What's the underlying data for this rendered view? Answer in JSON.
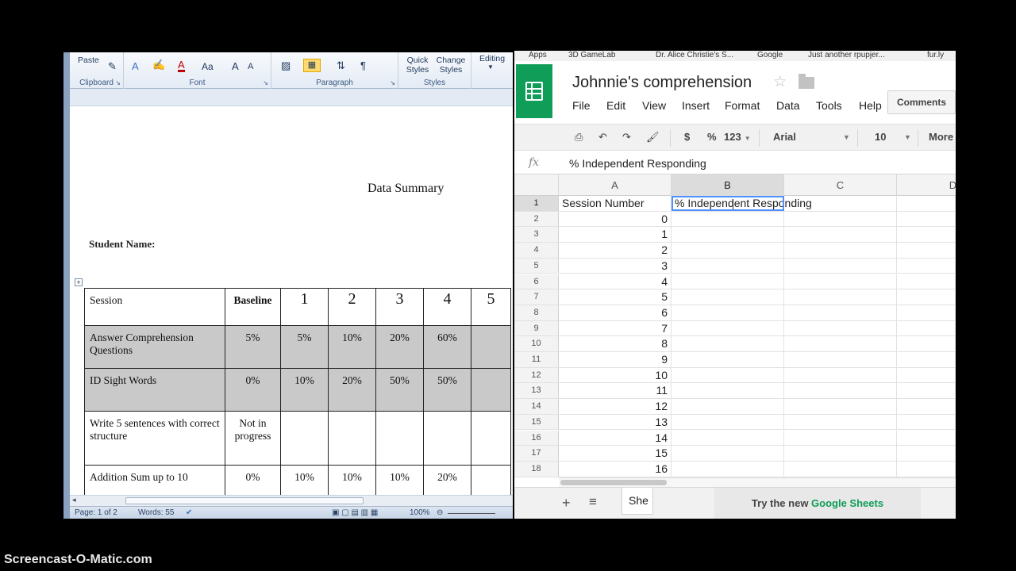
{
  "word": {
    "ribbon": {
      "paste_label": "Paste",
      "clipboard_label": "Clipboard",
      "font_label": "Font",
      "paragraph_label": "Paragraph",
      "quick_styles_label": "Quick Styles",
      "change_styles_label": "Change Styles",
      "styles_label": "Styles",
      "editing_label": "Editing",
      "font_size_grow": "A",
      "font_case": "Aa"
    },
    "document": {
      "title": "Data Summary",
      "student_label": "Student Name:",
      "table": {
        "header": [
          "Session",
          "Baseline",
          "1",
          "2",
          "3",
          "4",
          "5"
        ],
        "rows": [
          {
            "label": "Answer Comprehension Questions",
            "baseline": "5%",
            "values": [
              "5%",
              "10%",
              "20%",
              "60%",
              ""
            ]
          },
          {
            "label": "ID Sight Words",
            "baseline": "0%",
            "values": [
              "10%",
              "20%",
              "50%",
              "50%",
              ""
            ]
          },
          {
            "label": "Write 5 sentences with correct structure",
            "baseline": "Not in progress",
            "values": [
              "",
              "",
              "",
              "",
              ""
            ]
          },
          {
            "label": "Addition Sum up to 10",
            "baseline": "0%",
            "values": [
              "10%",
              "10%",
              "10%",
              "20%",
              ""
            ]
          }
        ]
      }
    },
    "status": {
      "page": "Page: 1 of 2",
      "words": "Words: 55",
      "zoom": "100%"
    }
  },
  "sheets": {
    "bookmarks": [
      "Apps",
      "3D GameLab",
      "Dr. Alice Christie's S...",
      "Google",
      "Just another rpupjer...",
      "fur.ly"
    ],
    "doc_name": "Johnnie's comprehension",
    "menu": [
      "File",
      "Edit",
      "View",
      "Insert",
      "Format",
      "Data",
      "Tools",
      "Help"
    ],
    "comments_label": "Comments",
    "toolbar": {
      "currency": "$",
      "percent": "%",
      "number_format": "123",
      "font": "Arial",
      "font_size": "10",
      "more": "More"
    },
    "formula_bar": {
      "fx": "fx",
      "value": "% Independent Responding"
    },
    "columns": [
      "A",
      "B",
      "C",
      "D"
    ],
    "rows": [
      {
        "num": "1",
        "a": "Session Number",
        "b": "% Independent Responding"
      },
      {
        "num": "2",
        "a": "0",
        "b": ""
      },
      {
        "num": "3",
        "a": "1",
        "b": ""
      },
      {
        "num": "4",
        "a": "2",
        "b": ""
      },
      {
        "num": "5",
        "a": "3",
        "b": ""
      },
      {
        "num": "6",
        "a": "4",
        "b": ""
      },
      {
        "num": "7",
        "a": "5",
        "b": ""
      },
      {
        "num": "8",
        "a": "6",
        "b": ""
      },
      {
        "num": "9",
        "a": "7",
        "b": ""
      },
      {
        "num": "10",
        "a": "8",
        "b": ""
      },
      {
        "num": "11",
        "a": "9",
        "b": ""
      },
      {
        "num": "12",
        "a": "10",
        "b": ""
      },
      {
        "num": "13",
        "a": "11",
        "b": ""
      },
      {
        "num": "14",
        "a": "12",
        "b": ""
      },
      {
        "num": "15",
        "a": "13",
        "b": ""
      },
      {
        "num": "16",
        "a": "14",
        "b": ""
      },
      {
        "num": "17",
        "a": "15",
        "b": ""
      },
      {
        "num": "18",
        "a": "16",
        "b": ""
      }
    ],
    "sheet_tab": "She",
    "try_new_prefix": "Try the new ",
    "try_new_accent": "Google Sheets"
  },
  "watermark": "Screencast-O-Matic.com"
}
